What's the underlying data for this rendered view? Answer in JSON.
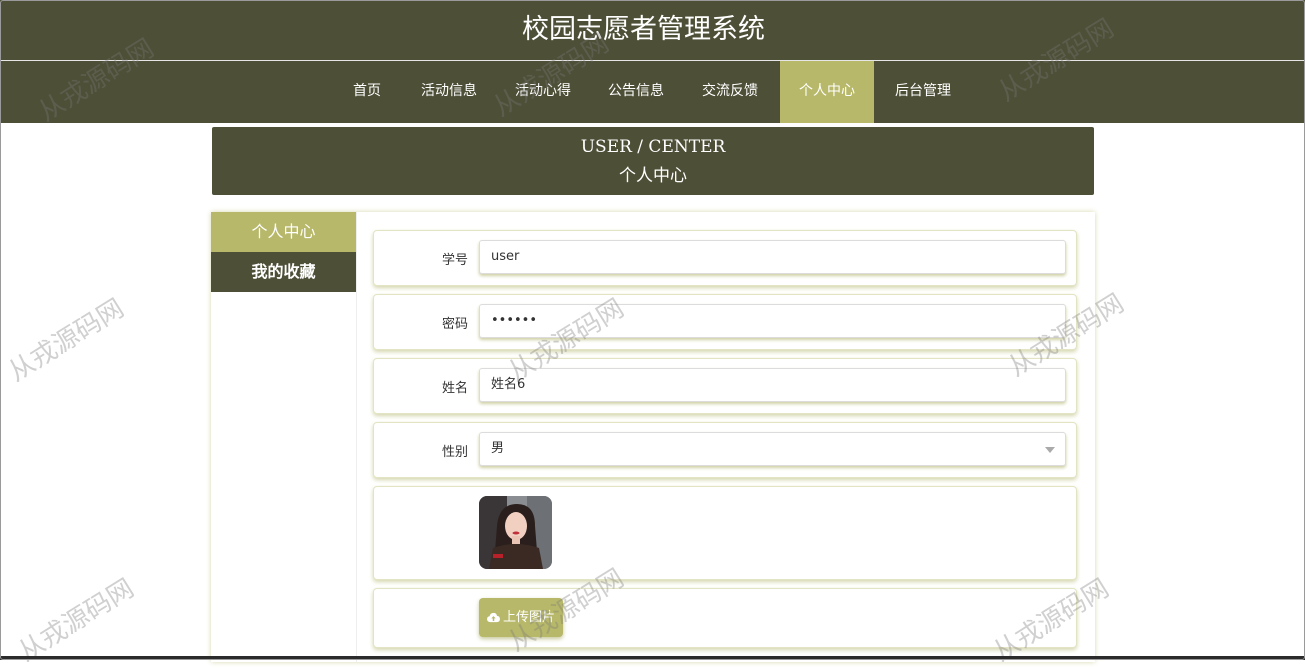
{
  "site": {
    "title": "校园志愿者管理系统"
  },
  "nav": {
    "items": [
      {
        "label": "首页"
      },
      {
        "label": "活动信息"
      },
      {
        "label": "活动心得"
      },
      {
        "label": "公告信息"
      },
      {
        "label": "交流反馈"
      },
      {
        "label": "个人中心",
        "active": true
      },
      {
        "label": "后台管理"
      }
    ]
  },
  "banner": {
    "title_en": "USER / CENTER",
    "title_cn": "个人中心"
  },
  "sidebar": {
    "items": [
      {
        "label": "个人中心",
        "active": true
      },
      {
        "label": "我的收藏"
      }
    ]
  },
  "form": {
    "student_id": {
      "label": "学号",
      "value": "user"
    },
    "password": {
      "label": "密码",
      "value": "••••••"
    },
    "name": {
      "label": "姓名",
      "value": "姓名6"
    },
    "gender": {
      "label": "性别",
      "value": "男"
    },
    "upload": {
      "label": "上传图片",
      "icon": "cloud-upload-icon"
    }
  },
  "watermark": {
    "text": "从戎源码网"
  },
  "colors": {
    "primary": "#4e4f37",
    "accent": "#b7b869",
    "background": "#ffffff"
  }
}
